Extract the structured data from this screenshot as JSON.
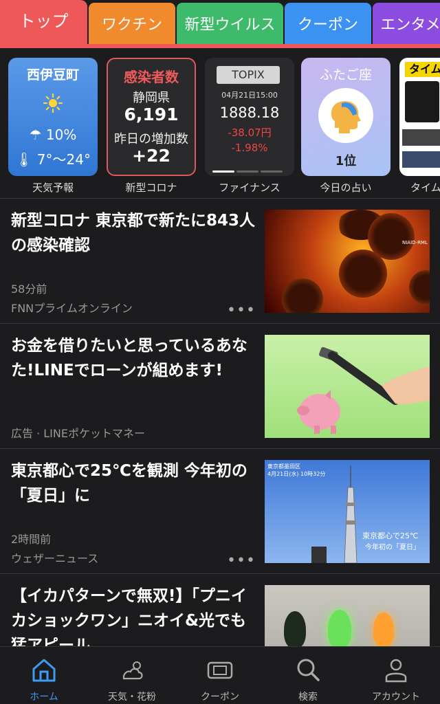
{
  "tabs": [
    {
      "label": "トップ",
      "color": "#ef5858"
    },
    {
      "label": "ワクチン",
      "color": "#f08a2c"
    },
    {
      "label": "新型ウイルス",
      "color": "#3dbb6a"
    },
    {
      "label": "クーポン",
      "color": "#3c92f0"
    },
    {
      "label": "エンタメ",
      "color": "#8c4ce0"
    }
  ],
  "cards": {
    "weather": {
      "place": "西伊豆町",
      "icon": "sun-icon",
      "rain": "☂ 10%",
      "temp": "🌡 7°〜24°",
      "caption": "天気予報"
    },
    "covid": {
      "title": "感染者数",
      "pref": "静岡県",
      "count": "6,191",
      "label": "昨日の増加数",
      "increase": "+22",
      "caption": "新型コロナ"
    },
    "finance": {
      "badge": "TOPIX",
      "date": "04月21日15:00",
      "price": "1888.18",
      "change": "-38.07円",
      "pct": "-1.98%",
      "caption": "ファイナンス"
    },
    "fortune": {
      "sign": "ふたご座",
      "icon": "head-icon",
      "rank": "1位",
      "caption": "今日の占い"
    },
    "ad": {
      "logo": "タイム",
      "caption": "タイム"
    }
  },
  "news": [
    {
      "title": "新型コロナ 東京都で新たに843人の感染確認",
      "time": "58分前",
      "source": "FNNプライムオンライン",
      "thumb_text": "NIAID-RML"
    },
    {
      "title": "お金を借りたいと思っているあなた!LINEでローンが組めます!",
      "time": "",
      "source": "広告 · LINEポケットマネー"
    },
    {
      "title": "東京都心で25℃を観測 今年初の「夏日」に",
      "time": "2時間前",
      "source": "ウェザーニュース",
      "thumb_caption_top": "東京都墨田区",
      "thumb_caption_date": "4月21日(水) 10時32分",
      "thumb_caption_main": "東京都心で25℃",
      "thumb_caption_sub": "今年初の「夏日」"
    },
    {
      "title": "【イカパターンで無双!】「プニイカショックワン」ニオイ&光でも猛アピール",
      "time": "",
      "source": ""
    }
  ],
  "more_label": "•••",
  "bottom_nav": [
    {
      "label": "ホーム",
      "icon": "home-icon"
    },
    {
      "label": "天気・花粉",
      "icon": "weather-icon"
    },
    {
      "label": "クーポン",
      "icon": "coupon-icon"
    },
    {
      "label": "検索",
      "icon": "search-icon"
    },
    {
      "label": "アカウント",
      "icon": "account-icon"
    }
  ]
}
